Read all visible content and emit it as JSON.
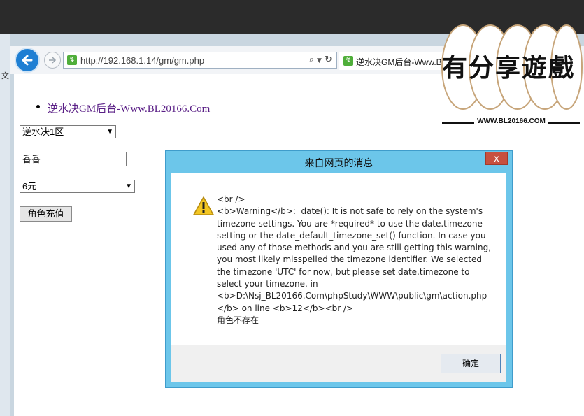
{
  "browser": {
    "address": "http://192.168.1.14/gm/gm.php",
    "tab_title": "逆水决GM后台-Www.B",
    "left_glyph": "文"
  },
  "page": {
    "link_text": "逆水决GM后台-Www.BL20166.Com",
    "server_select": "逆水决1区",
    "role_input": "香香",
    "amount_select": "6元",
    "recharge_button": "角色充值"
  },
  "dialog": {
    "title": "来自网页的消息",
    "close_label": "x",
    "message": "<br />\n<b>Warning</b>:  date(): It is not safe to rely on the system's\ntimezone settings. You are *required* to use the date.timezone\nsetting or the date_default_timezone_set() function. In case you\nused any of those methods and you are still getting this warning,\nyou most likely misspelled the timezone identifier. We selected\nthe timezone 'UTC' for now, but please set date.timezone to\nselect your timezone. in\n<b>D:\\Nsj_BL20166.Com\\phpStudy\\WWW\\public\\gm\\action.php\n</b> on line <b>12</b><br />\n角色不存在",
    "ok_button": "确定"
  },
  "watermark": {
    "title": "有分享遊戲",
    "url": "WWW.BL20166.COM"
  },
  "colors": {
    "dialog_frame": "#6cc6ea",
    "close_red": "#c7503f",
    "link_purple": "#5a1f86",
    "back_blue": "#1f7fd3"
  }
}
